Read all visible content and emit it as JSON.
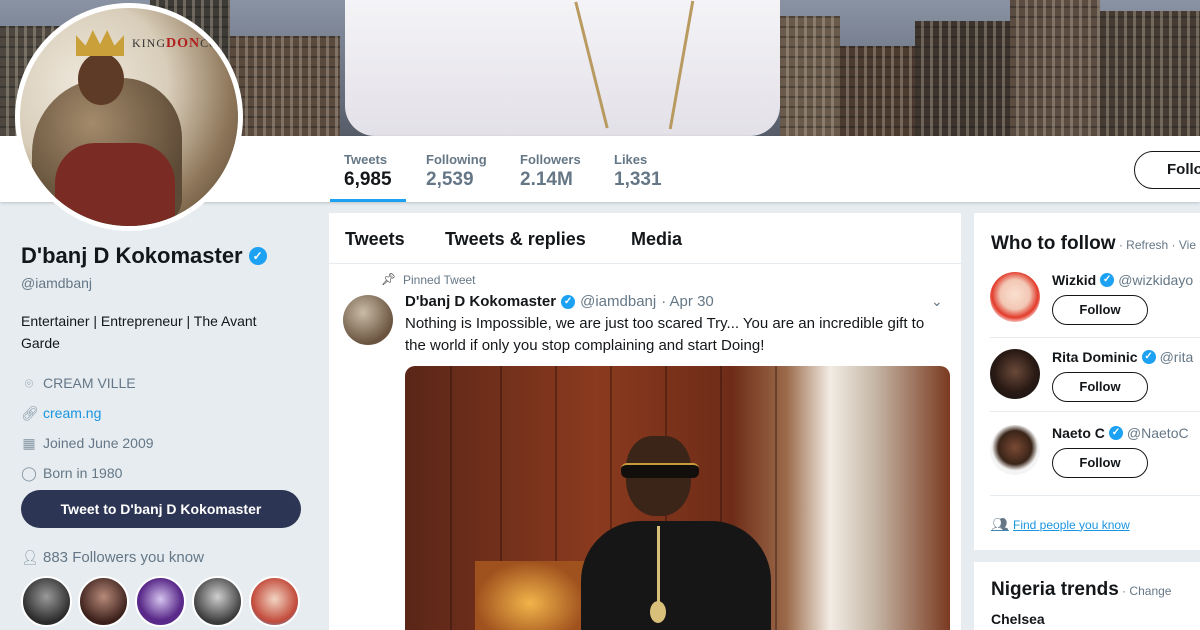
{
  "profile": {
    "name": "D'banj D Kokomaster",
    "handle": "@iamdbanj",
    "bio": "Entertainer | Entrepreneur | The Avant Garde",
    "location": "CREAM VILLE",
    "website": "cream.ng",
    "joined": "Joined June 2009",
    "born": "Born in 1980",
    "avatar_text_king": "KING",
    "avatar_text_don": "DON",
    "avatar_text_co": "Co"
  },
  "stats": [
    {
      "label": "Tweets",
      "value": "6,985"
    },
    {
      "label": "Following",
      "value": "2,539"
    },
    {
      "label": "Followers",
      "value": "2.14M"
    },
    {
      "label": "Likes",
      "value": "1,331"
    }
  ],
  "follow_button": "Follo",
  "tweet_to_button": "Tweet to D'banj D Kokomaster",
  "followers_you_know": "883 Followers you know",
  "timeline": {
    "tabs": [
      "Tweets",
      "Tweets & replies",
      "Media"
    ],
    "pinned_label": "Pinned Tweet",
    "tweet": {
      "name": "D'banj D Kokomaster",
      "handle": "@iamdbanj",
      "date": "· Apr 30",
      "text": "Nothing is Impossible,  we are just too scared Try... You are an incredible gift to the world if only you stop complaining and start Doing!"
    }
  },
  "who_to_follow": {
    "title": "Who to follow",
    "meta": " · Refresh · Vie",
    "suggestions": [
      {
        "name": "Wizkid",
        "handle": "@wizkidayo",
        "button": "Follow",
        "verified": true
      },
      {
        "name": "Rita Dominic",
        "handle": "@rita",
        "button": "Follow",
        "verified": true
      },
      {
        "name": "Naeto C",
        "handle": "@NaetoC",
        "button": "Follow",
        "verified": true
      }
    ],
    "find_people": "Find people you know"
  },
  "trends": {
    "title": "Nigeria trends",
    "meta": " · Change",
    "items": [
      "Chelsea"
    ]
  },
  "colors": {
    "accent": "#1da1f2",
    "tweet_to_bg": "#2c3553",
    "page_bg": "#e6ecf0"
  }
}
